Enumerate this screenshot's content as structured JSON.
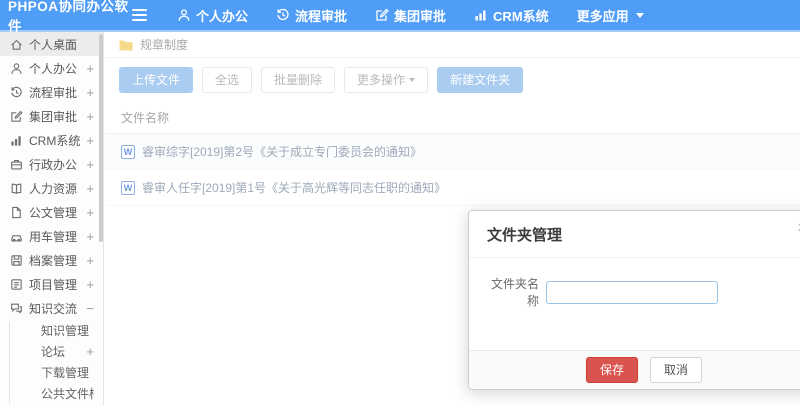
{
  "topbar": {
    "logo": "PHPOA协同办公软件",
    "nav": [
      {
        "label": "个人办公",
        "icon": "user-icon"
      },
      {
        "label": "流程审批",
        "icon": "history-icon"
      },
      {
        "label": "集团审批",
        "icon": "edit-icon"
      },
      {
        "label": "CRM系统",
        "icon": "chart-icon"
      },
      {
        "label": "更多应用",
        "icon": "caret-down-icon"
      }
    ]
  },
  "sidebar": {
    "items": [
      {
        "label": "个人桌面",
        "icon": "home-icon",
        "expand": ""
      },
      {
        "label": "个人办公",
        "icon": "user-icon",
        "expand": "+"
      },
      {
        "label": "流程审批",
        "icon": "history-icon",
        "expand": "+"
      },
      {
        "label": "集团审批",
        "icon": "edit-icon",
        "expand": "+"
      },
      {
        "label": "CRM系统",
        "icon": "chart-icon",
        "expand": "+"
      },
      {
        "label": "行政办公",
        "icon": "briefcase-icon",
        "expand": "+"
      },
      {
        "label": "人力资源",
        "icon": "book-icon",
        "expand": "+"
      },
      {
        "label": "公文管理",
        "icon": "document-icon",
        "expand": "+"
      },
      {
        "label": "用车管理",
        "icon": "car-icon",
        "expand": "+"
      },
      {
        "label": "档案管理",
        "icon": "archive-icon",
        "expand": "+"
      },
      {
        "label": "项目管理",
        "icon": "project-icon",
        "expand": "+"
      },
      {
        "label": "知识交流",
        "icon": "comments-icon",
        "expand": "−"
      }
    ],
    "subitems": [
      {
        "label": "知识管理",
        "expand": ""
      },
      {
        "label": "论坛",
        "expand": "+"
      },
      {
        "label": "下载管理",
        "expand": ""
      },
      {
        "label": "公共文件柜",
        "expand": ""
      }
    ]
  },
  "content": {
    "breadcrumb": "规章制度",
    "toolbar": {
      "upload": "上传文件",
      "select_all": "全选",
      "batch_delete": "批量删除",
      "more_ops": "更多操作",
      "new_folder": "新建文件夹"
    },
    "table": {
      "header": "文件名称",
      "file_icon_letter": "W",
      "files": [
        {
          "name": "睿审综字[2019]第2号《关于成立专门委员会的通知》"
        },
        {
          "name": "睿审人任字[2019]第1号《关于高光辉等同志任职的通知》"
        }
      ]
    }
  },
  "modal": {
    "title": "文件夹管理",
    "close": "×",
    "field_label": "文件夹名称",
    "input_value": "",
    "save": "保存",
    "cancel": "取消"
  },
  "colors": {
    "topbar_blue": "#4f9df6",
    "washed_button_blue": "#abccf1",
    "danger_red": "#d9534f",
    "folder_yellow": "#f6d98a"
  }
}
